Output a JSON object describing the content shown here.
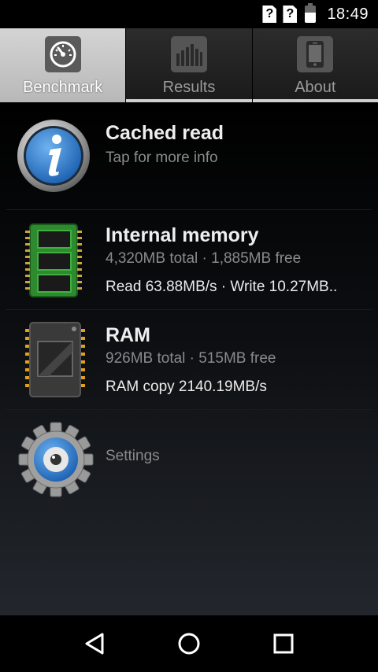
{
  "status_bar": {
    "sim1": "?",
    "sim2": "?",
    "time": "18:49",
    "icons": [
      "sim-unknown-icon",
      "sim-unknown-icon",
      "battery-icon"
    ]
  },
  "tabs": [
    {
      "label": "Benchmark",
      "icon": "speedometer-icon",
      "active": true
    },
    {
      "label": "Results",
      "icon": "bar-chart-icon",
      "active": false
    },
    {
      "label": "About",
      "icon": "phone-icon",
      "active": false
    }
  ],
  "items": {
    "cached_read": {
      "title": "Cached read",
      "subtitle": "Tap for more info",
      "icon": "info-icon"
    },
    "internal_memory": {
      "title": "Internal memory",
      "subtitle": "4,320MB total · 1,885MB free",
      "detail": "Read 63.88MB/s · Write 10.27MB..",
      "icon": "memory-card-icon"
    },
    "ram": {
      "title": "RAM",
      "subtitle": "926MB total · 515MB free",
      "detail": "RAM copy 2140.19MB/s",
      "icon": "ram-chip-icon"
    },
    "settings": {
      "label": "Settings",
      "icon": "gear-icon"
    }
  },
  "nav": {
    "buttons": [
      "back-icon",
      "home-icon",
      "recents-icon"
    ]
  },
  "colors": {
    "accent_blue": "#2a78c8",
    "card_green": "#3a9a3a",
    "tab_active": "#c8c8c8"
  }
}
